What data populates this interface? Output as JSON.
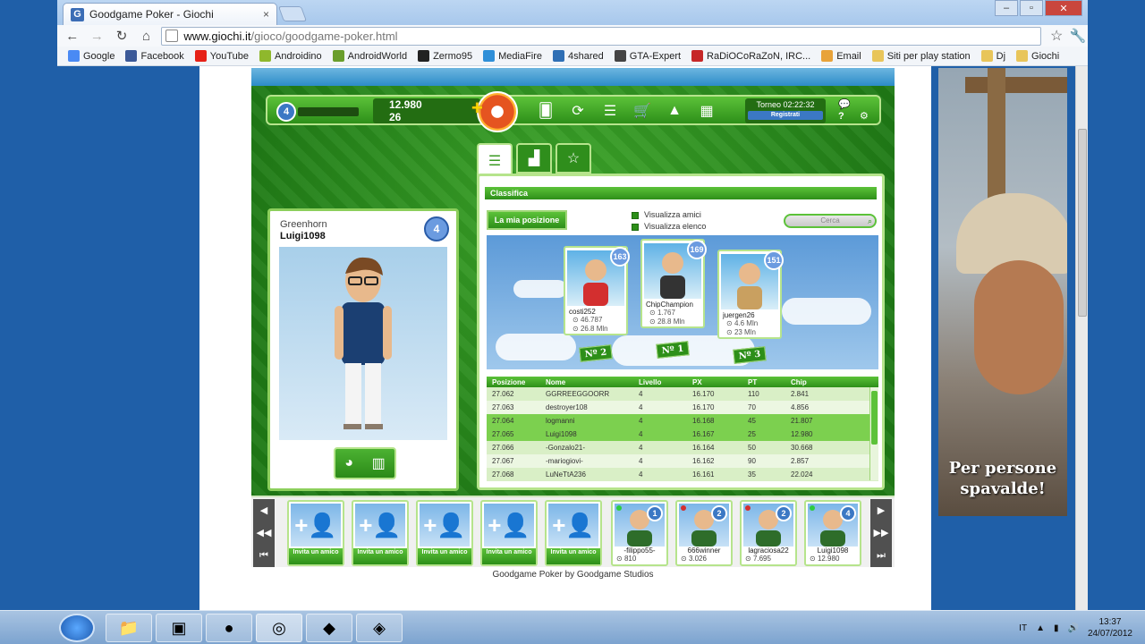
{
  "browser": {
    "tab_title": "Goodgame Poker - Giochi",
    "tab_close": "×",
    "url_host": "www.giochi.it",
    "url_path": "/gioco/goodgame-poker.html",
    "window_controls": [
      "–",
      "▫",
      "✕"
    ],
    "nav": {
      "back": "←",
      "forward": "→",
      "reload": "↻",
      "home": "⌂"
    },
    "bookmarks": [
      {
        "label": "Google",
        "color": "#4a8af4"
      },
      {
        "label": "Facebook",
        "color": "#3b5998"
      },
      {
        "label": "YouTube",
        "color": "#e62117"
      },
      {
        "label": "Androidino",
        "color": "#8fb82c"
      },
      {
        "label": "AndroidWorld",
        "color": "#6a9e2c"
      },
      {
        "label": "Zermo95",
        "color": "#222222"
      },
      {
        "label": "MediaFire",
        "color": "#2f8fd8"
      },
      {
        "label": "4shared",
        "color": "#2f6fb5"
      },
      {
        "label": "GTA-Expert",
        "color": "#444444"
      },
      {
        "label": "RaDiOCoRaZoN, IRC...",
        "color": "#c62828"
      },
      {
        "label": "Email",
        "color": "#e8a33a"
      },
      {
        "label": "Siti per play station",
        "color": "#e8c55a"
      },
      {
        "label": "Dj",
        "color": "#e8c55a"
      },
      {
        "label": "Giochi",
        "color": "#e8c55a"
      }
    ]
  },
  "hud": {
    "level": "4",
    "chips": "12.980",
    "gold": "26",
    "tournament_label": "Torneo 02:22:32",
    "register_label": "Registrati",
    "help_label": "?",
    "settings_icon": "⚙",
    "chat_icon": "💬"
  },
  "profile": {
    "rank_title": "Greenhorn",
    "username": "Luigi1098",
    "level": "4"
  },
  "ranking": {
    "title": "Classifica",
    "my_position_button": "La mia posizione",
    "show_friends": "Visualizza amici",
    "show_list": "Visualizza elenco",
    "search_placeholder": "Cerca",
    "podium": [
      {
        "place": "Nº 2",
        "name": "costi252",
        "level": "163",
        "chips": "46.787",
        "px": "26.8 Mln"
      },
      {
        "place": "Nº 1",
        "name": "ChipChampion",
        "level": "169",
        "chips": "1.767",
        "px": "28.8 Mln"
      },
      {
        "place": "Nº 3",
        "name": "juergen26",
        "level": "151",
        "chips": "4.6 Mln",
        "px": "23 Mln"
      }
    ],
    "columns": [
      "Posizione",
      "Nome",
      "Livello",
      "PX",
      "PT",
      "Chip"
    ],
    "rows": [
      [
        "27.062",
        "GGRREEGGOORR",
        "4",
        "16.170",
        "110",
        "2.841"
      ],
      [
        "27.063",
        "destroyer108",
        "4",
        "16.170",
        "70",
        "4.856"
      ],
      [
        "27.064",
        "logmanni",
        "4",
        "16.168",
        "45",
        "21.807"
      ],
      [
        "27.065",
        "Luigi1098",
        "4",
        "16.167",
        "25",
        "12.980"
      ],
      [
        "27.066",
        "-Gonzalo21-",
        "4",
        "16.164",
        "50",
        "30.668"
      ],
      [
        "27.067",
        "-mariogiovi-",
        "4",
        "16.162",
        "90",
        "2.857"
      ],
      [
        "27.068",
        "LuNeTtA236",
        "4",
        "16.161",
        "35",
        "22.024"
      ]
    ]
  },
  "friends": {
    "invite_label": "Invita un amico",
    "players": [
      {
        "name": "-filippo55-",
        "chips": "810",
        "level": "1",
        "status": "#2ecc40"
      },
      {
        "name": "666winner",
        "chips": "3.026",
        "level": "2",
        "status": "#d32f2f"
      },
      {
        "name": "lagraciosa22",
        "chips": "7.695",
        "level": "2",
        "status": "#d32f2f"
      },
      {
        "name": "Luigi1098",
        "chips": "12.980",
        "level": "4",
        "status": "#2ecc40"
      }
    ]
  },
  "credit": "Goodgame Poker by Goodgame Studios",
  "ad": {
    "line1": "Per persone",
    "line2": "spavalde!"
  },
  "taskbar": {
    "language": "IT",
    "time": "13:37",
    "date": "24/07/2012"
  }
}
